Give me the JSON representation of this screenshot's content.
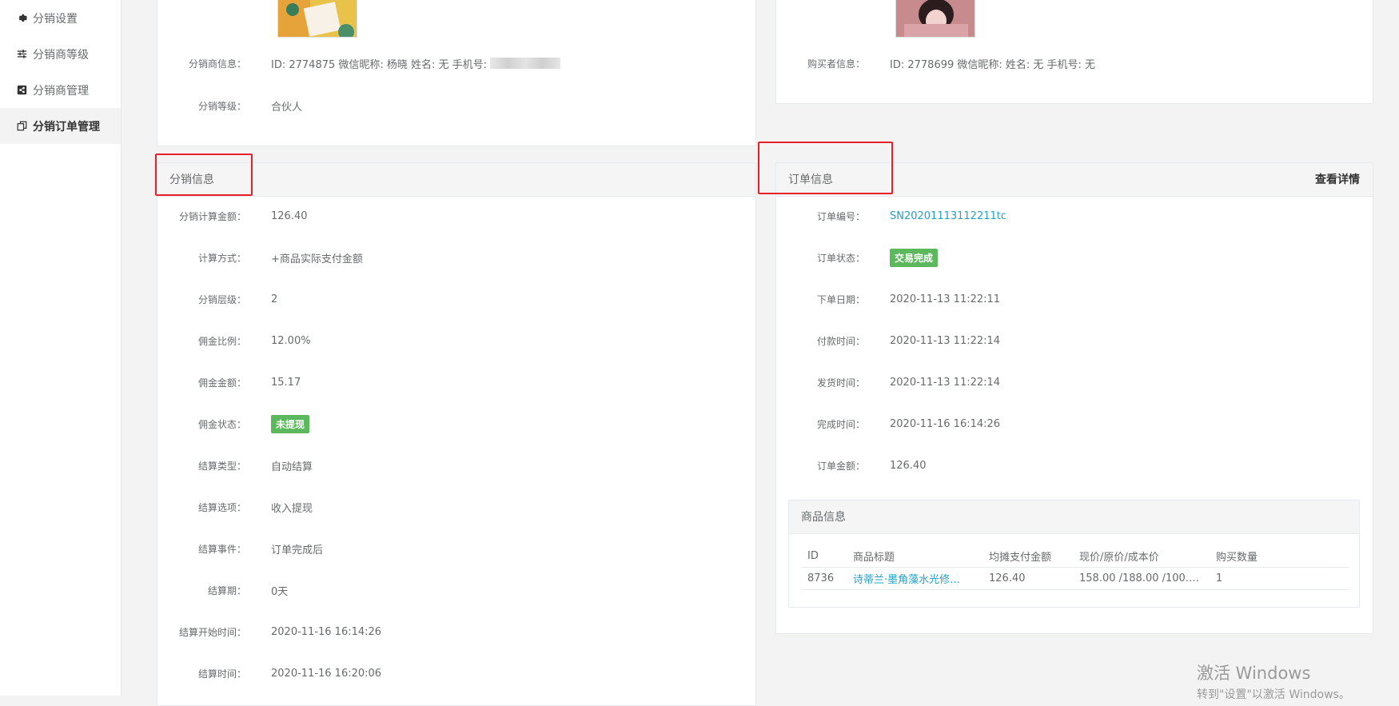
{
  "sidebar": {
    "items": [
      {
        "label": "分销设置",
        "icon": "gear-icon"
      },
      {
        "label": "分销商等级",
        "icon": "sliders-icon"
      },
      {
        "label": "分销商管理",
        "icon": "share-icon"
      },
      {
        "label": "分销订单管理",
        "icon": "copy-icon",
        "active": true
      }
    ]
  },
  "distributor": {
    "info_label": "分销商信息：",
    "info_value": "ID: 2774875   微信昵称: 杨晓   姓名: 无   手机号:",
    "level_label": "分销等级：",
    "level_value": "合伙人"
  },
  "buyer": {
    "info_label": "购买者信息：",
    "info_value": "ID: 2778699   微信昵称:   姓名: 无   手机号: 无"
  },
  "distribution_info": {
    "title": "分销信息",
    "rows": [
      {
        "label": "分销计算金额：",
        "value": "126.40"
      },
      {
        "label": "计算方式：",
        "value": "+商品实际支付金额"
      },
      {
        "label": "分销层级：",
        "value": "2"
      },
      {
        "label": "佣金比例：",
        "value": "12.00%"
      },
      {
        "label": "佣金金额：",
        "value": "15.17"
      },
      {
        "label": "佣金状态：",
        "value": "未提现",
        "badge": true
      },
      {
        "label": "结算类型：",
        "value": "自动结算"
      },
      {
        "label": "结算选项：",
        "value": "收入提现"
      },
      {
        "label": "结算事件：",
        "value": "订单完成后"
      },
      {
        "label": "结算期：",
        "value": "0天"
      },
      {
        "label": "结算开始时间：",
        "value": "2020-11-16 16:14:26"
      },
      {
        "label": "结算时间：",
        "value": "2020-11-16 16:20:06"
      }
    ]
  },
  "order_info": {
    "title": "订单信息",
    "detail_link": "查看详情",
    "rows": [
      {
        "label": "订单编号：",
        "value": "SN20201113112211tc",
        "link": true
      },
      {
        "label": "订单状态：",
        "value": "交易完成",
        "badge": true
      },
      {
        "label": "下单日期：",
        "value": "2020-11-13 11:22:11"
      },
      {
        "label": "付款时间：",
        "value": "2020-11-13 11:22:14"
      },
      {
        "label": "发货时间：",
        "value": "2020-11-13 11:22:14"
      },
      {
        "label": "完成时间：",
        "value": "2020-11-16 16:14:26"
      },
      {
        "label": "订单金额：",
        "value": "126.40"
      }
    ]
  },
  "product_info": {
    "title": "商品信息",
    "columns": [
      "ID",
      "商品标题",
      "均摊支付金额",
      "现价/原价/成本价",
      "购买数量"
    ],
    "rows": [
      [
        "8736",
        "诗蒂兰·墨角藻水光修…",
        "126.40",
        "158.00 /188.00 /100.0…",
        "1"
      ]
    ]
  },
  "watermark": {
    "line1": "激活 Windows",
    "line2": "转到\"设置\"以激活 Windows。"
  },
  "colors": {
    "accent_link": "#23a0c4",
    "badge_green": "#5cb85c",
    "highlight_red": "#e8202a"
  }
}
